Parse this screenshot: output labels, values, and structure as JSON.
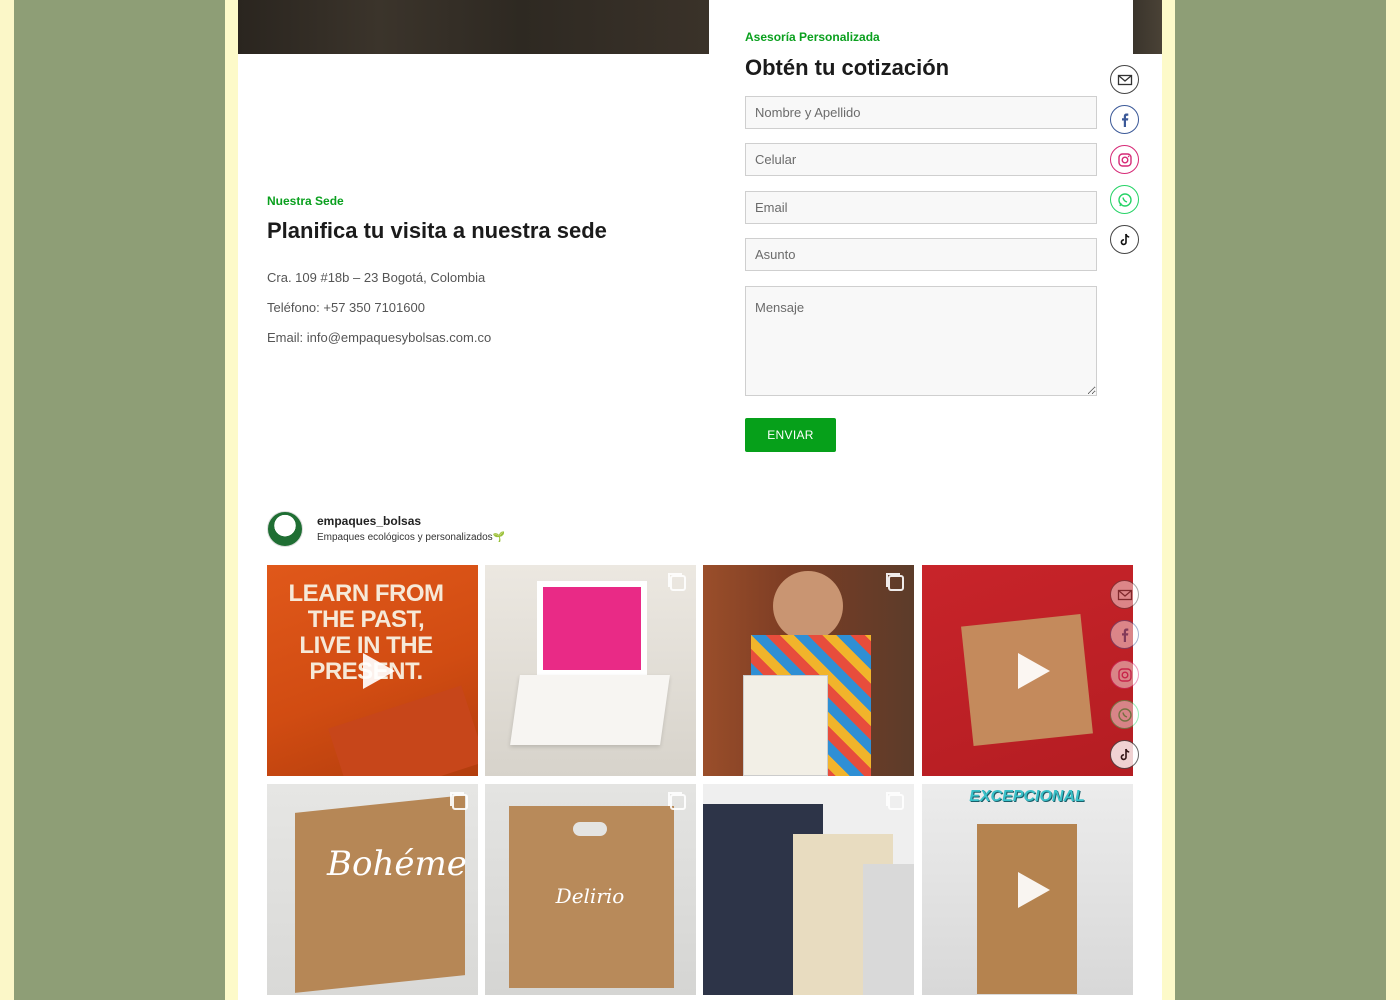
{
  "contact": {
    "eyebrow": "Nuestra Sede",
    "title": "Planifica tu visita a nuestra sede",
    "address": "Cra. 109 #18b – 23 Bogotá, Colombia",
    "phone": "Teléfono: +57 350 7101600",
    "email": "Email: info@empaquesybolsas.com.co"
  },
  "quote_form": {
    "eyebrow": "Asesoría Personalizada",
    "title": "Obtén tu cotización",
    "name_placeholder": "Nombre y Apellido",
    "phone_placeholder": "Celular",
    "email_placeholder": "Email",
    "subject_placeholder": "Asunto",
    "message_placeholder": "Mensaje",
    "submit_label": "ENVIAR"
  },
  "social_icons": [
    "mail-icon",
    "facebook-icon",
    "instagram-icon",
    "whatsapp-icon",
    "tiktok-icon"
  ],
  "instagram_feed": {
    "username": "empaques_bolsas",
    "bio": "Empaques ecológicos y personalizados🌱",
    "posts": [
      {
        "kind": "video",
        "text": "LEARN FROM THE PAST, LIVE IN THE PRESENT."
      },
      {
        "kind": "carousel",
        "text": ""
      },
      {
        "kind": "carousel",
        "text": ""
      },
      {
        "kind": "video",
        "text": ""
      },
      {
        "kind": "carousel",
        "text": "Bohéme"
      },
      {
        "kind": "carousel",
        "text": "Delirio"
      },
      {
        "kind": "carousel",
        "text": ""
      },
      {
        "kind": "video",
        "text": "EXCEPCIONAL"
      }
    ]
  },
  "colors": {
    "accent_green": "#06a01a",
    "outer_background": "#8e9e76",
    "frame_background": "#fdfac9"
  }
}
